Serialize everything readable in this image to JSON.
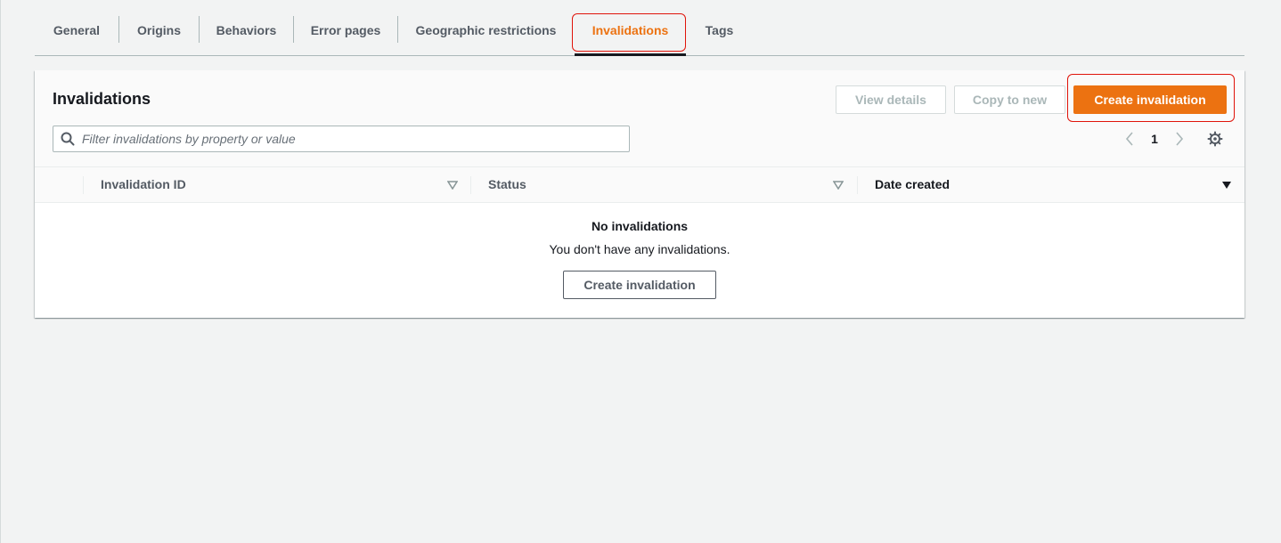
{
  "tabs": [
    {
      "label": "General"
    },
    {
      "label": "Origins"
    },
    {
      "label": "Behaviors"
    },
    {
      "label": "Error pages"
    },
    {
      "label": "Geographic restrictions"
    },
    {
      "label": "Invalidations"
    },
    {
      "label": "Tags"
    }
  ],
  "active_tab": "Invalidations",
  "panel": {
    "title": "Invalidations",
    "buttons": {
      "view_details": "View details",
      "copy_to_new": "Copy to new",
      "create_invalidation": "Create invalidation"
    },
    "search": {
      "placeholder": "Filter invalidations by property or value",
      "value": ""
    },
    "pagination": {
      "current_page": "1"
    }
  },
  "table": {
    "columns": [
      {
        "label": "Invalidation ID",
        "sort": "sortable"
      },
      {
        "label": "Status",
        "sort": "sortable"
      },
      {
        "label": "Date created",
        "sort": "descending"
      }
    ],
    "rows": [],
    "empty_state": {
      "title": "No invalidations",
      "description": "You don't have any invalidations.",
      "button_label": "Create invalidation"
    }
  },
  "colors": {
    "accent": "#ec7211",
    "highlight": "#e0140a",
    "background": "#f2f3f3"
  },
  "icons": [
    "search-icon",
    "chevron-left-icon",
    "chevron-right-icon",
    "gear-icon",
    "sort-icon",
    "sort-descending-icon"
  ]
}
